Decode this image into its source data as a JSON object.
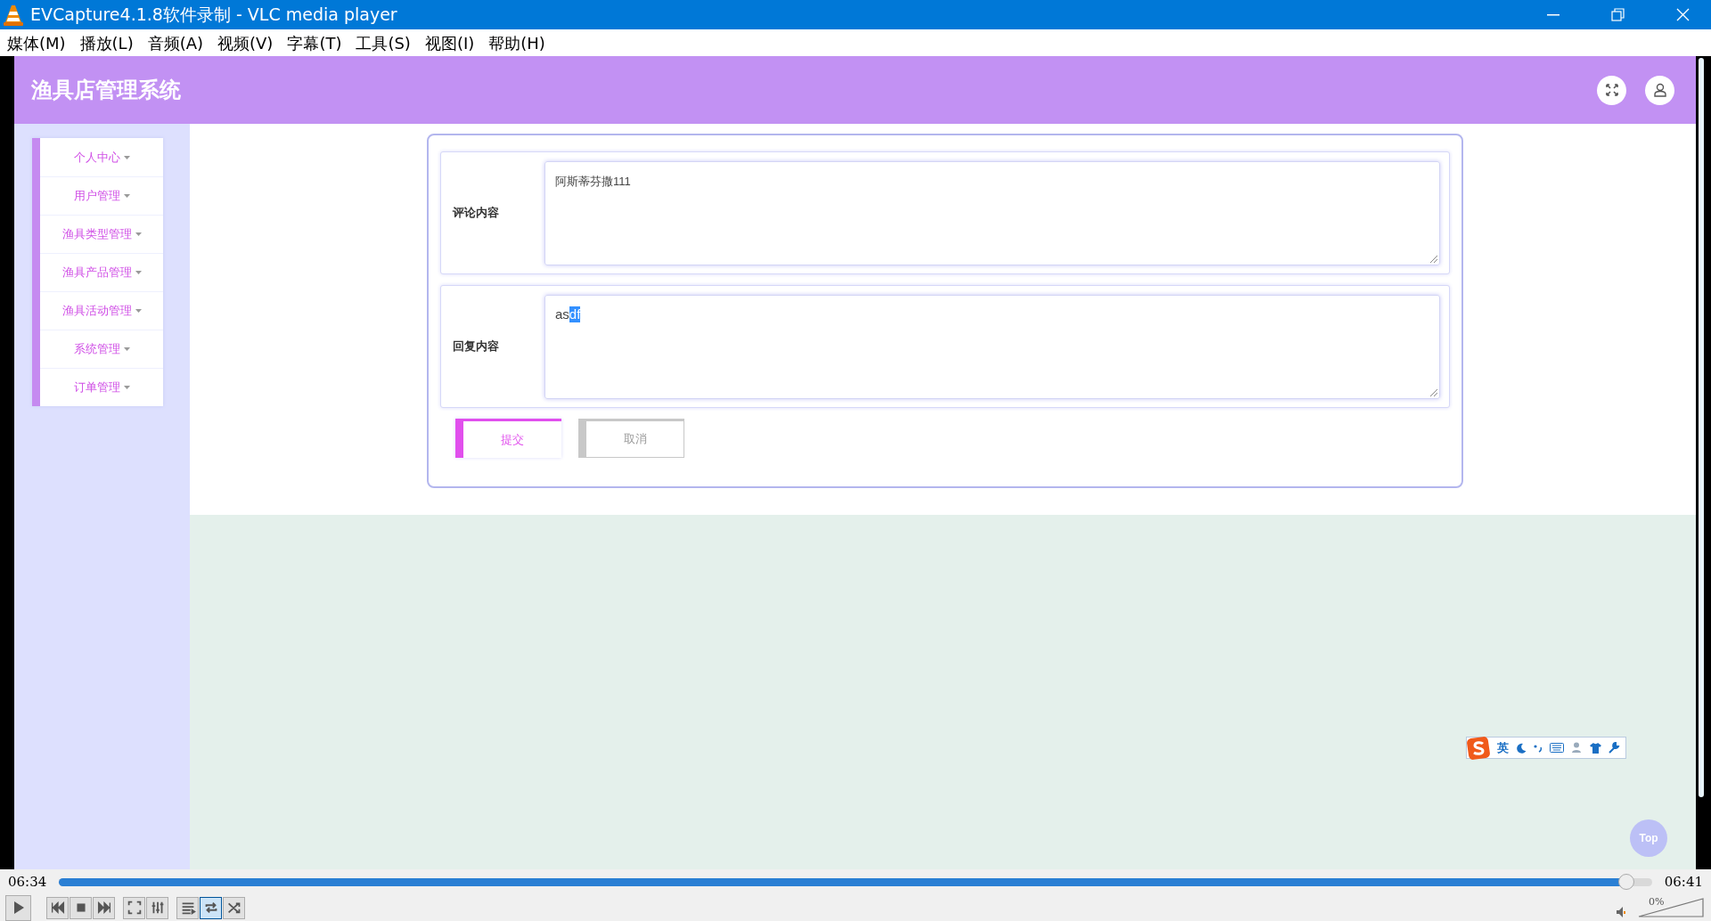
{
  "window": {
    "title": "EVCapture4.1.8软件录制 - VLC media player"
  },
  "menu": [
    "媒体(M)",
    "播放(L)",
    "音频(A)",
    "视频(V)",
    "字幕(T)",
    "工具(S)",
    "视图(I)",
    "帮助(H)"
  ],
  "app": {
    "title": "渔具店管理系统",
    "sidebar": {
      "items": [
        {
          "label": "个人中心"
        },
        {
          "label": "用户管理"
        },
        {
          "label": "渔具类型管理"
        },
        {
          "label": "渔具产品管理"
        },
        {
          "label": "渔具活动管理"
        },
        {
          "label": "系统管理"
        },
        {
          "label": "订单管理"
        }
      ]
    },
    "form": {
      "fields": [
        {
          "label": "评论内容",
          "value": [
            {
              "text": "阿斯蒂芬撒111",
              "selected": false
            }
          ]
        },
        {
          "label": "回复内容",
          "value": [
            {
              "text": "as",
              "selected": false
            },
            {
              "text": "df",
              "selected": true
            }
          ]
        }
      ],
      "buttons": [
        {
          "label": "提交",
          "kind": "primary"
        },
        {
          "label": "取消",
          "kind": "secondary"
        }
      ]
    },
    "top_button": "Top",
    "ime_toolbar": {
      "mode": "英"
    }
  },
  "player": {
    "elapsed": "06:34",
    "total": "06:41",
    "progress": {
      "level": 0.984
    },
    "volume": {
      "level": 0,
      "reading": "0%"
    },
    "controls": [
      {
        "kind": "play",
        "on": false
      },
      {
        "kind": "prev",
        "on": false
      },
      {
        "kind": "stop",
        "on": false
      },
      {
        "kind": "next",
        "on": false
      },
      {
        "kind": "fullscreen",
        "on": false
      },
      {
        "kind": "effects",
        "on": false
      },
      {
        "kind": "playlist",
        "on": false
      },
      {
        "kind": "loop",
        "on": true
      },
      {
        "kind": "shuffle",
        "on": false
      }
    ]
  }
}
